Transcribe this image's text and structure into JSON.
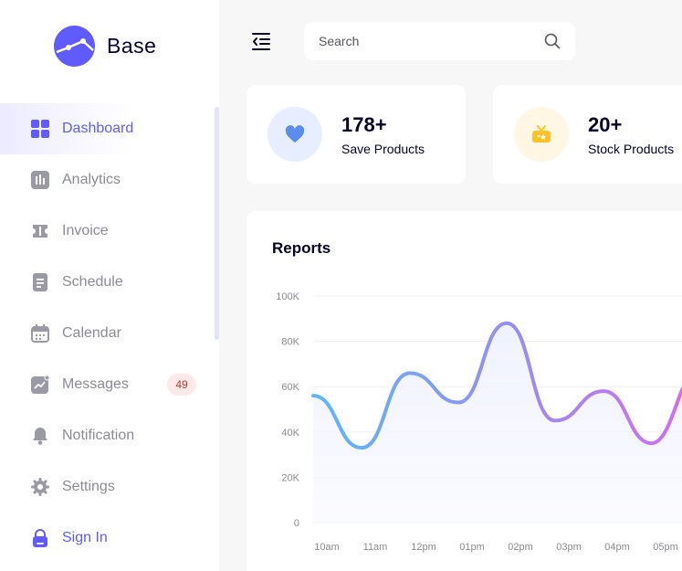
{
  "brand": {
    "name": "Base"
  },
  "colors": {
    "accent": "#605bff",
    "line_start": "#5db8f5",
    "line_end": "#d36cf5"
  },
  "sidebar": {
    "items": [
      {
        "label": "Dashboard",
        "icon": "grid-icon",
        "active": true
      },
      {
        "label": "Analytics",
        "icon": "bar-chart-icon"
      },
      {
        "label": "Invoice",
        "icon": "ticket-icon"
      },
      {
        "label": "Schedule",
        "icon": "document-icon"
      },
      {
        "label": "Calendar",
        "icon": "calendar-icon"
      },
      {
        "label": "Messages",
        "icon": "chat-chart-icon",
        "badge": "49"
      },
      {
        "label": "Notification",
        "icon": "bell-icon"
      },
      {
        "label": "Settings",
        "icon": "gear-icon"
      },
      {
        "label": "Sign In",
        "icon": "lock-icon"
      }
    ]
  },
  "search": {
    "placeholder": "Search"
  },
  "stats": [
    {
      "value": "178+",
      "label": "Save Products",
      "icon": "heart-icon"
    },
    {
      "value": "20+",
      "label": "Stock Products",
      "icon": "gift-icon"
    }
  ],
  "reports": {
    "title": "Reports",
    "chart_data": {
      "type": "line",
      "title": "Reports",
      "x": [
        "10am",
        "11am",
        "12pm",
        "01pm",
        "02pm",
        "03pm",
        "04pm",
        "05pm"
      ],
      "y_ticks": [
        "100K",
        "80K",
        "60K",
        "40K",
        "20K",
        "0"
      ],
      "ylim": [
        0,
        100000
      ],
      "grid": true,
      "series": [
        {
          "values": [
            56000,
            33000,
            66000,
            53000,
            88000,
            45000,
            58000,
            35000
          ]
        }
      ]
    }
  }
}
